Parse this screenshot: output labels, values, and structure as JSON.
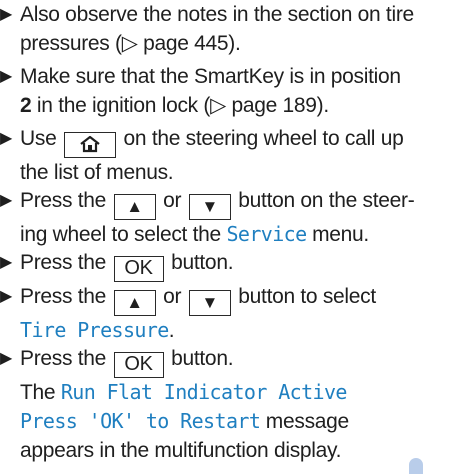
{
  "steps": [
    {
      "lines": [
        "Also observe the notes in the section on tire",
        "pressures (▷ page 445)."
      ]
    },
    {
      "line1": "Make sure that the SmartKey is in position",
      "num": "2",
      "line2_rest": " in the ignition lock (▷ page 189)."
    },
    {
      "pre": "Use",
      "post": "on the steering wheel to call up",
      "line2": "the list of menus.",
      "home_icon": "home-icon"
    },
    {
      "pre": "Press the",
      "or": "or",
      "post": "button on the steer-",
      "line2_pre": "ing wheel to select the ",
      "menu": "Service",
      "line2_post": " menu.",
      "up_glyph": "▲",
      "down_glyph": "▼"
    },
    {
      "pre": "Press the",
      "key": "OK",
      "post": "button."
    },
    {
      "pre": "Press the",
      "or": "or",
      "post": "button to select",
      "item": "Tire Pressure",
      "item_post": ".",
      "up_glyph": "▲",
      "down_glyph": "▼"
    },
    {
      "pre": "Press the",
      "key": "OK",
      "post": "button.",
      "line2_pre": "The ",
      "msg1": "Run Flat Indicator Active",
      "msg2": "Press 'OK' to Restart",
      "line3_post": " message",
      "line4": "appears in the multifunction display."
    }
  ],
  "arrow_glyph": "▶",
  "colors": {
    "text": "#1f1f1f",
    "display_text": "#1f7fc0"
  }
}
